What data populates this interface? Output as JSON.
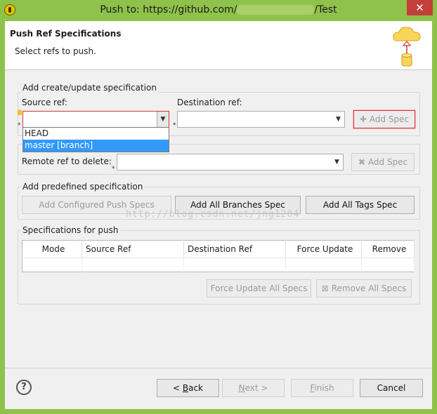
{
  "window": {
    "title_prefix": "Push to: https://github.com/",
    "title_suffix": "/Test",
    "close_glyph": "✕"
  },
  "header": {
    "title": "Push Ref Specifications",
    "subtitle": "Select refs to push."
  },
  "create_group": {
    "label": "Add create/update specification",
    "source_label": "Source ref:",
    "source_value": "",
    "destination_label": "Destination ref:",
    "destination_value": "",
    "add_spec_label": "Add Spec",
    "source_options": [
      "HEAD",
      "master [branch]"
    ],
    "selected_option": "master [branch]"
  },
  "delete_group": {
    "remote_label": "Remote ref to delete:",
    "remote_value": "",
    "add_spec_label": "Add Spec"
  },
  "predefined_group": {
    "label": "Add predefined specification",
    "configured_label": "Add Configured Push Specs",
    "all_branches_label": "Add All Branches Spec",
    "all_tags_label": "Add All Tags Spec"
  },
  "specs_group": {
    "label": "Specifications for push",
    "columns": [
      "Mode",
      "Source Ref",
      "Destination Ref",
      "Force Update",
      "Remove"
    ],
    "force_update_all_label": "Force Update All Specs",
    "remove_all_label": "Remove All Specs"
  },
  "watermark": "http://blog.csdn.net/jng1204",
  "footer": {
    "back_key": "B",
    "back_rest": "ack",
    "next_key": "N",
    "next_rest": "ext >",
    "finish_key": "F",
    "finish_rest": "inish",
    "cancel_label": "Cancel",
    "help_glyph": "?"
  },
  "icons": {
    "help": "help-icon",
    "add": "plus-icon",
    "delete": "x-icon",
    "header": "cloud-push-icon"
  },
  "colors": {
    "titlebar": "#8fc24a",
    "focus_border": "#e03030",
    "selection": "#3399ff",
    "close_button": "#c43f3a"
  }
}
